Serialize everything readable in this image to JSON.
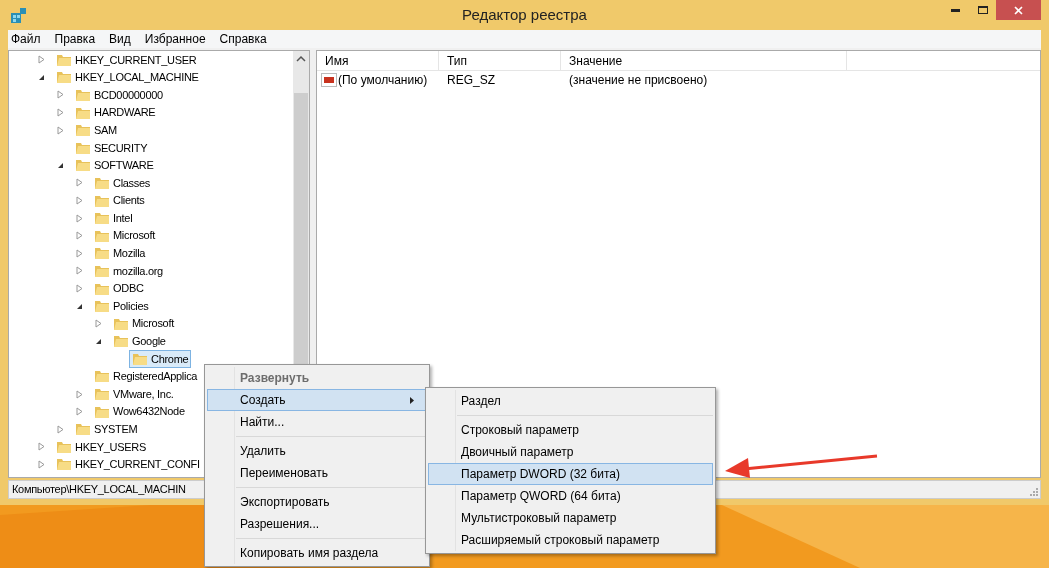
{
  "window": {
    "title": "Редактор реестра"
  },
  "menu_bar": [
    "Файл",
    "Правка",
    "Вид",
    "Избранное",
    "Справка"
  ],
  "tree": [
    {
      "label": "HKEY_CURRENT_USER",
      "kind": "branch",
      "expanded": false,
      "selected": false
    },
    {
      "label": "HKEY_LOCAL_MACHINE",
      "kind": "branch",
      "expanded": true,
      "selected": false,
      "children": [
        {
          "label": "BCD00000000",
          "kind": "branch",
          "expanded": false,
          "selected": false
        },
        {
          "label": "HARDWARE",
          "kind": "branch",
          "expanded": false,
          "selected": false
        },
        {
          "label": "SAM",
          "kind": "branch",
          "expanded": false,
          "selected": false
        },
        {
          "label": "SECURITY",
          "kind": "leaf",
          "selected": false
        },
        {
          "label": "SOFTWARE",
          "kind": "branch",
          "expanded": true,
          "selected": false,
          "children": [
            {
              "label": "Classes",
              "kind": "branch",
              "expanded": false,
              "selected": false
            },
            {
              "label": "Clients",
              "kind": "branch",
              "expanded": false,
              "selected": false
            },
            {
              "label": "Intel",
              "kind": "branch",
              "expanded": false,
              "selected": false
            },
            {
              "label": "Microsoft",
              "kind": "branch",
              "expanded": false,
              "selected": false
            },
            {
              "label": "Mozilla",
              "kind": "branch",
              "expanded": false,
              "selected": false
            },
            {
              "label": "mozilla.org",
              "kind": "branch",
              "expanded": false,
              "selected": false
            },
            {
              "label": "ODBC",
              "kind": "branch",
              "expanded": false,
              "selected": false
            },
            {
              "label": "Policies",
              "kind": "branch",
              "expanded": true,
              "selected": false,
              "children": [
                {
                  "label": "Microsoft",
                  "kind": "branch",
                  "expanded": false,
                  "selected": false
                },
                {
                  "label": "Google",
                  "kind": "branch",
                  "expanded": true,
                  "selected": false,
                  "children": [
                    {
                      "label": "Chrome",
                      "kind": "leaf",
                      "selected": true
                    }
                  ]
                }
              ]
            },
            {
              "label": "RegisteredApplica",
              "kind": "leaf",
              "selected": false
            },
            {
              "label": "VMware, Inc.",
              "kind": "branch",
              "expanded": false,
              "selected": false
            },
            {
              "label": "Wow6432Node",
              "kind": "branch",
              "expanded": false,
              "selected": false
            }
          ]
        },
        {
          "label": "SYSTEM",
          "kind": "branch",
          "expanded": false,
          "selected": false
        }
      ]
    },
    {
      "label": "HKEY_USERS",
      "kind": "branch",
      "expanded": false,
      "selected": false
    },
    {
      "label": "HKEY_CURRENT_CONFI",
      "kind": "branch",
      "expanded": false,
      "selected": false
    }
  ],
  "values": {
    "columns": [
      "Имя",
      "Тип",
      "Значение"
    ],
    "rows": [
      {
        "name": "(По умолчанию)",
        "type": "REG_SZ",
        "data": "(значение не присвоено)"
      }
    ]
  },
  "status_bar": "Компьютер\\HKEY_LOCAL_MACHIN",
  "context_menu": [
    {
      "kind": "item",
      "label": "Развернуть",
      "default": true,
      "disabled": true,
      "selected": false,
      "has_submenu": false
    },
    {
      "kind": "item",
      "label": "Создать",
      "default": false,
      "disabled": false,
      "selected": true,
      "has_submenu": true
    },
    {
      "kind": "item",
      "label": "Найти...",
      "default": false,
      "disabled": false,
      "selected": false,
      "has_submenu": false
    },
    {
      "kind": "separator"
    },
    {
      "kind": "item",
      "label": "Удалить",
      "default": false,
      "disabled": false,
      "selected": false,
      "has_submenu": false
    },
    {
      "kind": "item",
      "label": "Переименовать",
      "default": false,
      "disabled": false,
      "selected": false,
      "has_submenu": false
    },
    {
      "kind": "separator"
    },
    {
      "kind": "item",
      "label": "Экспортировать",
      "default": false,
      "disabled": false,
      "selected": false,
      "has_submenu": false
    },
    {
      "kind": "item",
      "label": "Разрешения...",
      "default": false,
      "disabled": false,
      "selected": false,
      "has_submenu": false
    },
    {
      "kind": "separator"
    },
    {
      "kind": "item",
      "label": "Копировать имя раздела",
      "default": false,
      "disabled": false,
      "selected": false,
      "has_submenu": false
    }
  ],
  "submenu": [
    {
      "kind": "item",
      "label": "Раздел",
      "selected": false
    },
    {
      "kind": "separator"
    },
    {
      "kind": "item",
      "label": "Строковый параметр",
      "selected": false
    },
    {
      "kind": "item",
      "label": "Двоичный параметр",
      "selected": false
    },
    {
      "kind": "item",
      "label": "Параметр DWORD (32 бита)",
      "selected": true
    },
    {
      "kind": "item",
      "label": "Параметр QWORD (64 бита)",
      "selected": false
    },
    {
      "kind": "item",
      "label": "Мультистроковый параметр",
      "selected": false
    },
    {
      "kind": "item",
      "label": "Расширяемый строковый параметр",
      "selected": false
    }
  ]
}
